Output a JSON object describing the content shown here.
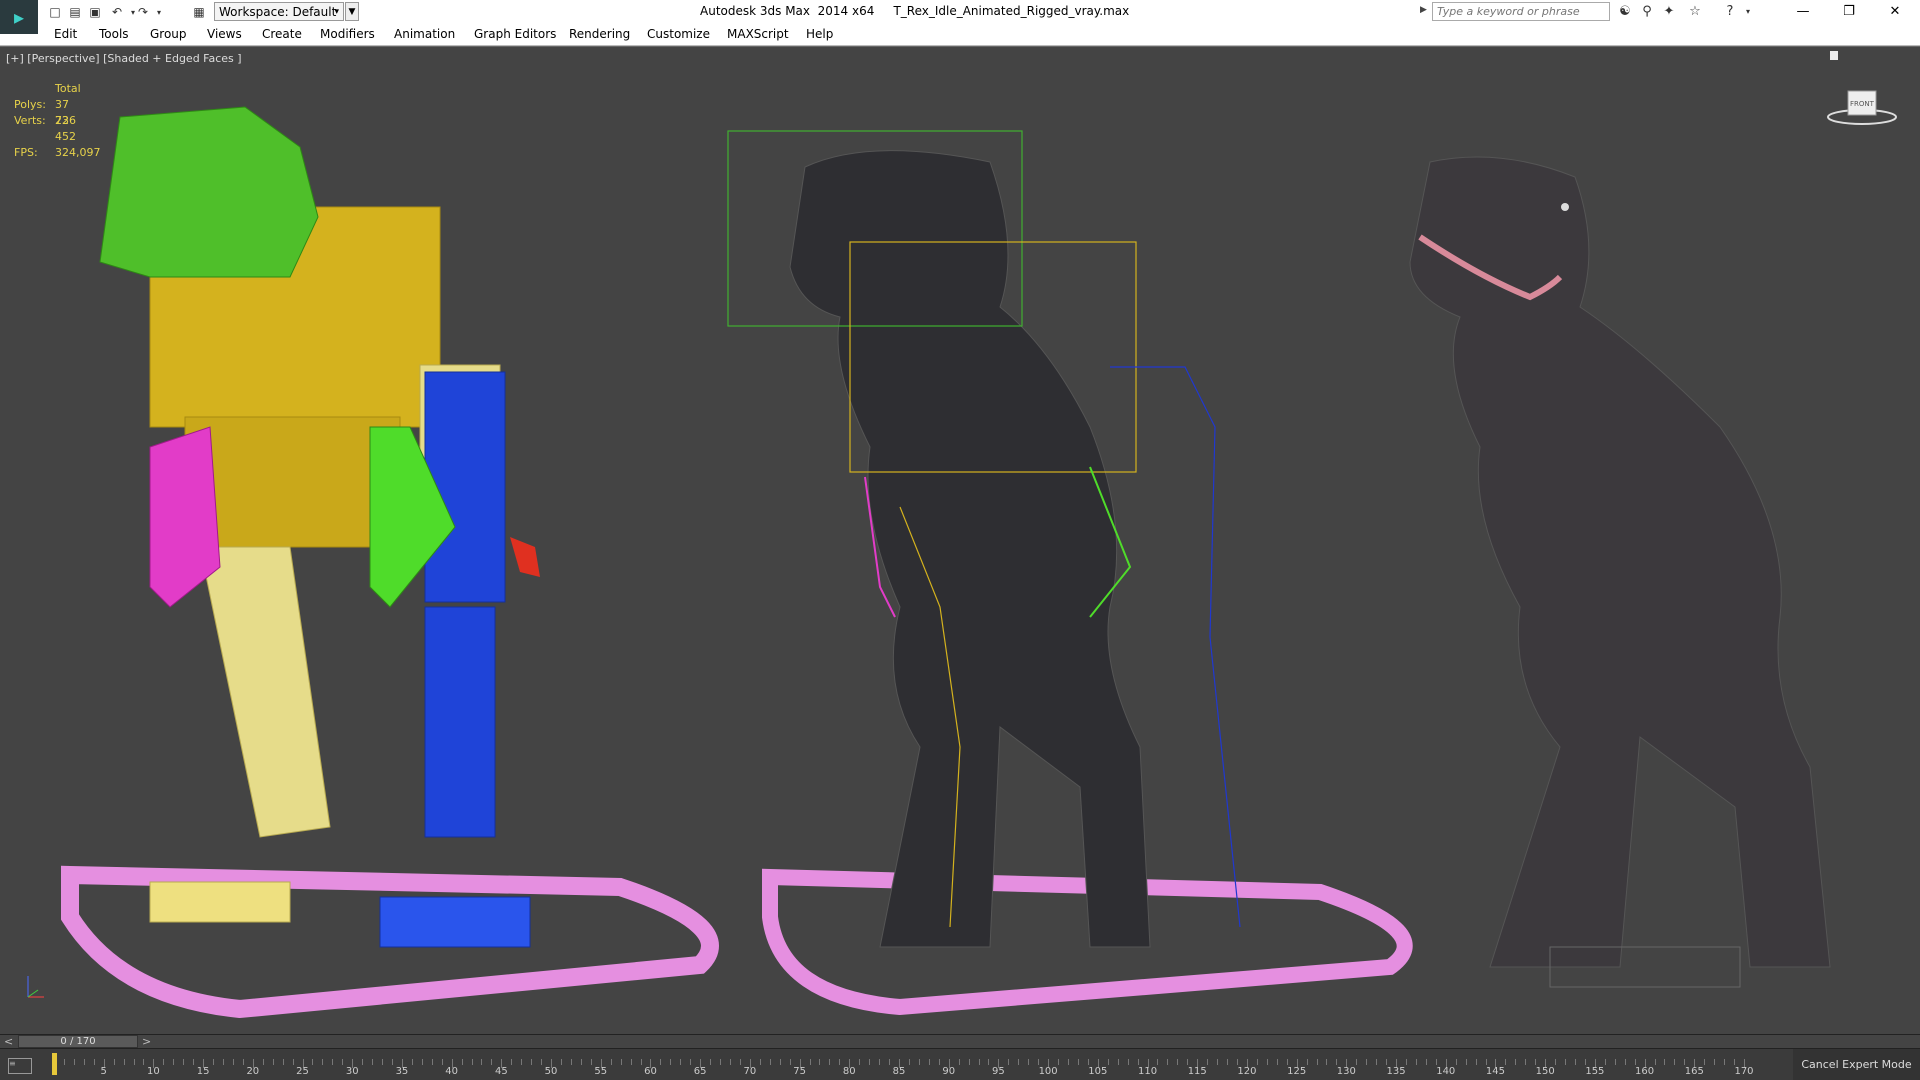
{
  "title_bar": {
    "app_title": "Autodesk 3ds Max  2014 x64",
    "file_name": "T_Rex_Idle_Animated_Rigged_vray.max",
    "workspace_label": "Workspace: Default",
    "search_placeholder": "Type a keyword or phrase"
  },
  "menu": {
    "items": [
      "Edit",
      "Tools",
      "Group",
      "Views",
      "Create",
      "Modifiers",
      "Animation",
      "Graph Editors",
      "Rendering",
      "Customize",
      "MAXScript",
      "Help"
    ]
  },
  "viewport": {
    "label": "[+] [Perspective] [Shaded + Edged Faces ]",
    "stats": {
      "header": "Total",
      "polys_label": "Polys:",
      "polys_value": "37 736",
      "verts_label": "Verts:",
      "verts_value": "22 452",
      "fps_label": "FPS:",
      "fps_value": "324,097"
    },
    "viewcube_label": "FRONT"
  },
  "timeline": {
    "slider_label": "0 / 170",
    "prev_label": "<",
    "next_label": ">",
    "current_frame": 0,
    "frame_end": 170,
    "ticks": [
      "5",
      "10",
      "15",
      "20",
      "25",
      "30",
      "35",
      "40",
      "45",
      "50",
      "55",
      "60",
      "65",
      "70",
      "75",
      "80",
      "85",
      "90",
      "95",
      "100",
      "105",
      "110",
      "115",
      "120",
      "125",
      "130",
      "135",
      "140",
      "145",
      "150",
      "155",
      "160",
      "165",
      "170"
    ]
  },
  "status": {
    "cancel_expert": "Cancel Expert Mode"
  },
  "colors": {
    "viewport_bg": "#444444",
    "stats_text": "#e7d24a",
    "rig_yellow": "#d4b21e",
    "rig_green": "#4fbf2a",
    "rig_blue": "#1f44d8",
    "rig_magenta": "#e23cc8",
    "rig_pink_base": "#e58fe0"
  }
}
